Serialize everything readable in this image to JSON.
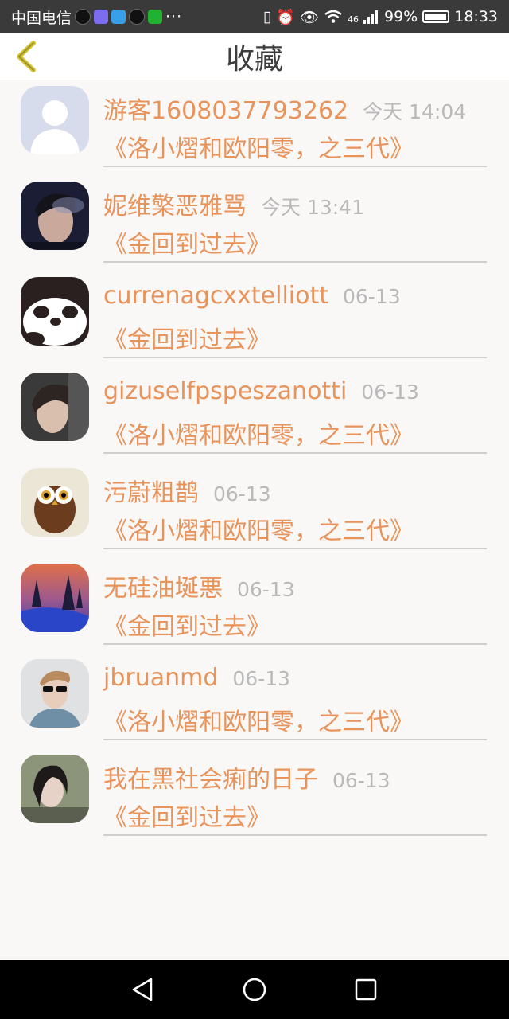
{
  "status_bar": {
    "carrier": "中国电信",
    "dots": "···",
    "network": "46",
    "battery": "99%",
    "time": "18:33"
  },
  "header": {
    "title": "收藏"
  },
  "items": [
    {
      "name": "游客1608037793262",
      "time": "今天 14:04",
      "book": "《洛小熠和欧阳零，之三代》",
      "avatar": "default-avatar"
    },
    {
      "name": "妮维檠恶雅骂",
      "time": "今天 13:41",
      "book": "《金回到过去》",
      "avatar": "smoking-boy"
    },
    {
      "name": "currenagcxxtelliott",
      "time": "06-13",
      "book": "《金回到过去》",
      "avatar": "panda"
    },
    {
      "name": "gizuselfpspeszanotti",
      "time": "06-13",
      "book": "《洛小熠和欧阳零，之三代》",
      "avatar": "boy-portrait"
    },
    {
      "name": "污蔚粗鹊",
      "time": "06-13",
      "book": "《洛小熠和欧阳零，之三代》",
      "avatar": "owl"
    },
    {
      "name": "无硅油埏悪",
      "time": "06-13",
      "book": "《金回到过去》",
      "avatar": "landscape"
    },
    {
      "name": "jbruanmd",
      "time": "06-13",
      "book": "《洛小熠和欧阳零，之三代》",
      "avatar": "sunglasses-man"
    },
    {
      "name": "我在黑社会痢的日子",
      "time": "06-13",
      "book": "《金回到过去》",
      "avatar": "girl"
    }
  ],
  "colors": {
    "accent": "#e8935a",
    "time": "#b9b9b9",
    "background": "#faf7f7"
  }
}
